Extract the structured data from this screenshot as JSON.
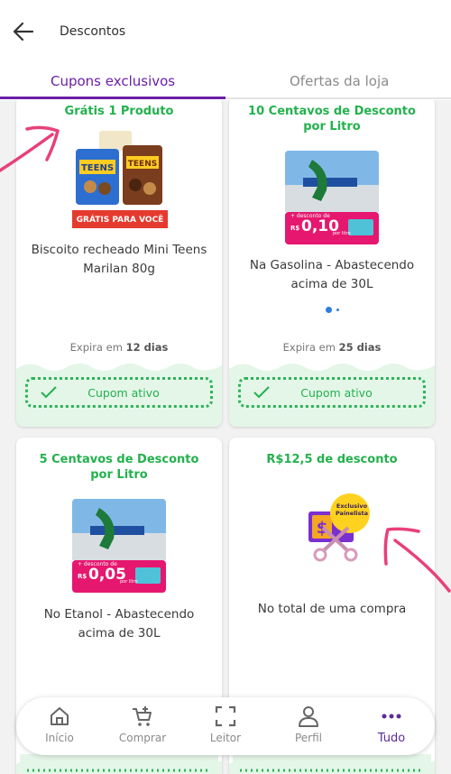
{
  "header": {
    "title": "Descontos"
  },
  "tabs": [
    {
      "label": "Cupons exclusivos",
      "active": true
    },
    {
      "label": "Ofertas da loja",
      "active": false
    }
  ],
  "cards": [
    {
      "title": "Grátis 1 Produto",
      "image_badge": "GRÁTIS PARA VOCÊ",
      "description": "Biscoito recheado Mini Teens Marilan 80g",
      "expires_prefix": "Expira em ",
      "expires_value": "12 dias",
      "status_label": "Cupom ativo"
    },
    {
      "title": "10 Centavos de Desconto por Litro",
      "image_price_prefix": "R$",
      "image_price": "0,10",
      "image_caption": "+ desconto de",
      "image_unit": "por litro",
      "description": "Na Gasolina - Abastecendo acima de 30L",
      "expires_prefix": "Expira em ",
      "expires_value": "25 dias",
      "status_label": "Cupom ativo"
    },
    {
      "title": "5 Centavos de Desconto por Litro",
      "image_price_prefix": "R$",
      "image_price": "0,05",
      "image_caption": "+ desconto de",
      "image_unit": "por litro",
      "description": "No Etanol - Abastecendo acima de 30L"
    },
    {
      "title": "R$12,5 de desconto",
      "image_badge": "Exclusivo Painelista",
      "description": "No total de uma compra"
    }
  ],
  "bottom_nav": [
    {
      "label": "Início",
      "icon": "home-icon"
    },
    {
      "label": "Comprar",
      "icon": "cart-plus-icon"
    },
    {
      "label": "Leitor",
      "icon": "scan-icon"
    },
    {
      "label": "Perfil",
      "icon": "person-icon"
    },
    {
      "label": "Tudo",
      "icon": "more-dots-icon",
      "active": true
    }
  ],
  "colors": {
    "accent_purple": "#6b1fa8",
    "green": "#23b14d",
    "pink_annotation": "#e8407a",
    "link_blue": "#2f7de1"
  }
}
